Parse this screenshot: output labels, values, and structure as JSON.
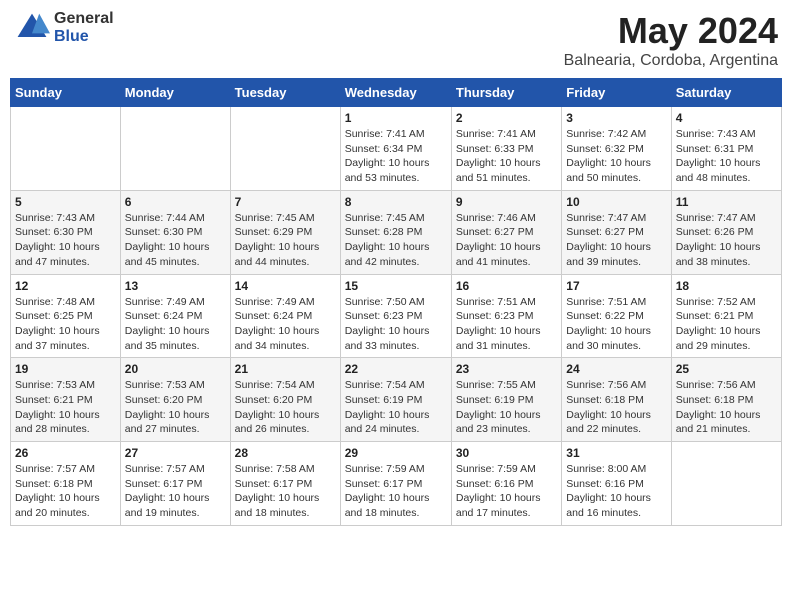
{
  "header": {
    "logo_general": "General",
    "logo_blue": "Blue",
    "title": "May 2024",
    "location": "Balnearia, Cordoba, Argentina"
  },
  "days_of_week": [
    "Sunday",
    "Monday",
    "Tuesday",
    "Wednesday",
    "Thursday",
    "Friday",
    "Saturday"
  ],
  "weeks": [
    [
      {
        "day": "",
        "info": ""
      },
      {
        "day": "",
        "info": ""
      },
      {
        "day": "",
        "info": ""
      },
      {
        "day": "1",
        "info": "Sunrise: 7:41 AM\nSunset: 6:34 PM\nDaylight: 10 hours\nand 53 minutes."
      },
      {
        "day": "2",
        "info": "Sunrise: 7:41 AM\nSunset: 6:33 PM\nDaylight: 10 hours\nand 51 minutes."
      },
      {
        "day": "3",
        "info": "Sunrise: 7:42 AM\nSunset: 6:32 PM\nDaylight: 10 hours\nand 50 minutes."
      },
      {
        "day": "4",
        "info": "Sunrise: 7:43 AM\nSunset: 6:31 PM\nDaylight: 10 hours\nand 48 minutes."
      }
    ],
    [
      {
        "day": "5",
        "info": "Sunrise: 7:43 AM\nSunset: 6:30 PM\nDaylight: 10 hours\nand 47 minutes."
      },
      {
        "day": "6",
        "info": "Sunrise: 7:44 AM\nSunset: 6:30 PM\nDaylight: 10 hours\nand 45 minutes."
      },
      {
        "day": "7",
        "info": "Sunrise: 7:45 AM\nSunset: 6:29 PM\nDaylight: 10 hours\nand 44 minutes."
      },
      {
        "day": "8",
        "info": "Sunrise: 7:45 AM\nSunset: 6:28 PM\nDaylight: 10 hours\nand 42 minutes."
      },
      {
        "day": "9",
        "info": "Sunrise: 7:46 AM\nSunset: 6:27 PM\nDaylight: 10 hours\nand 41 minutes."
      },
      {
        "day": "10",
        "info": "Sunrise: 7:47 AM\nSunset: 6:27 PM\nDaylight: 10 hours\nand 39 minutes."
      },
      {
        "day": "11",
        "info": "Sunrise: 7:47 AM\nSunset: 6:26 PM\nDaylight: 10 hours\nand 38 minutes."
      }
    ],
    [
      {
        "day": "12",
        "info": "Sunrise: 7:48 AM\nSunset: 6:25 PM\nDaylight: 10 hours\nand 37 minutes."
      },
      {
        "day": "13",
        "info": "Sunrise: 7:49 AM\nSunset: 6:24 PM\nDaylight: 10 hours\nand 35 minutes."
      },
      {
        "day": "14",
        "info": "Sunrise: 7:49 AM\nSunset: 6:24 PM\nDaylight: 10 hours\nand 34 minutes."
      },
      {
        "day": "15",
        "info": "Sunrise: 7:50 AM\nSunset: 6:23 PM\nDaylight: 10 hours\nand 33 minutes."
      },
      {
        "day": "16",
        "info": "Sunrise: 7:51 AM\nSunset: 6:23 PM\nDaylight: 10 hours\nand 31 minutes."
      },
      {
        "day": "17",
        "info": "Sunrise: 7:51 AM\nSunset: 6:22 PM\nDaylight: 10 hours\nand 30 minutes."
      },
      {
        "day": "18",
        "info": "Sunrise: 7:52 AM\nSunset: 6:21 PM\nDaylight: 10 hours\nand 29 minutes."
      }
    ],
    [
      {
        "day": "19",
        "info": "Sunrise: 7:53 AM\nSunset: 6:21 PM\nDaylight: 10 hours\nand 28 minutes."
      },
      {
        "day": "20",
        "info": "Sunrise: 7:53 AM\nSunset: 6:20 PM\nDaylight: 10 hours\nand 27 minutes."
      },
      {
        "day": "21",
        "info": "Sunrise: 7:54 AM\nSunset: 6:20 PM\nDaylight: 10 hours\nand 26 minutes."
      },
      {
        "day": "22",
        "info": "Sunrise: 7:54 AM\nSunset: 6:19 PM\nDaylight: 10 hours\nand 24 minutes."
      },
      {
        "day": "23",
        "info": "Sunrise: 7:55 AM\nSunset: 6:19 PM\nDaylight: 10 hours\nand 23 minutes."
      },
      {
        "day": "24",
        "info": "Sunrise: 7:56 AM\nSunset: 6:18 PM\nDaylight: 10 hours\nand 22 minutes."
      },
      {
        "day": "25",
        "info": "Sunrise: 7:56 AM\nSunset: 6:18 PM\nDaylight: 10 hours\nand 21 minutes."
      }
    ],
    [
      {
        "day": "26",
        "info": "Sunrise: 7:57 AM\nSunset: 6:18 PM\nDaylight: 10 hours\nand 20 minutes."
      },
      {
        "day": "27",
        "info": "Sunrise: 7:57 AM\nSunset: 6:17 PM\nDaylight: 10 hours\nand 19 minutes."
      },
      {
        "day": "28",
        "info": "Sunrise: 7:58 AM\nSunset: 6:17 PM\nDaylight: 10 hours\nand 18 minutes."
      },
      {
        "day": "29",
        "info": "Sunrise: 7:59 AM\nSunset: 6:17 PM\nDaylight: 10 hours\nand 18 minutes."
      },
      {
        "day": "30",
        "info": "Sunrise: 7:59 AM\nSunset: 6:16 PM\nDaylight: 10 hours\nand 17 minutes."
      },
      {
        "day": "31",
        "info": "Sunrise: 8:00 AM\nSunset: 6:16 PM\nDaylight: 10 hours\nand 16 minutes."
      },
      {
        "day": "",
        "info": ""
      }
    ]
  ]
}
